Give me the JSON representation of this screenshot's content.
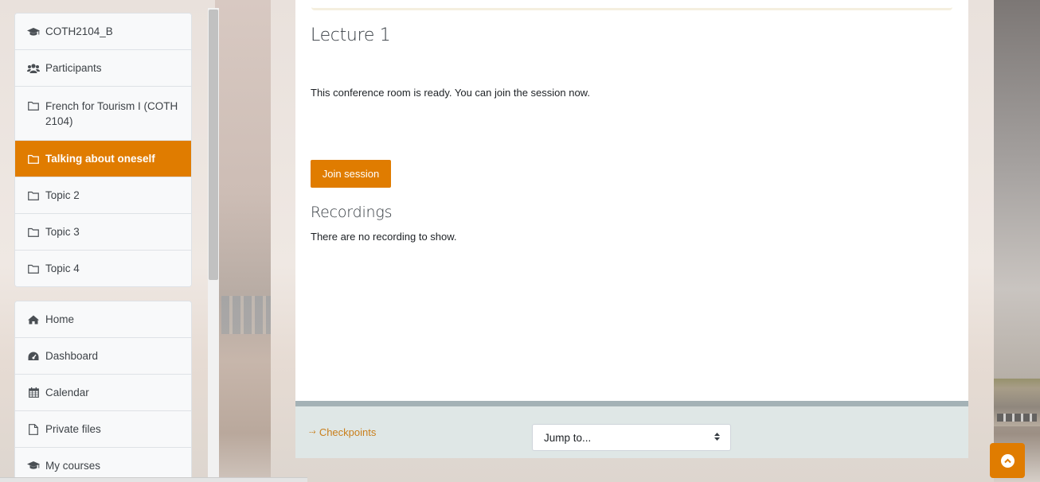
{
  "course_nav": [
    {
      "icon": "graduation-cap-icon",
      "label": "COTH2104_B",
      "active": false
    },
    {
      "icon": "users-icon",
      "label": "Participants",
      "active": false
    },
    {
      "icon": "folder-icon",
      "label": "French for Tourism I (COTH 2104)",
      "active": false
    },
    {
      "icon": "folder-icon",
      "label": "Talking about oneself",
      "active": true
    },
    {
      "icon": "folder-icon",
      "label": "Topic 2",
      "active": false
    },
    {
      "icon": "folder-icon",
      "label": "Topic 3",
      "active": false
    },
    {
      "icon": "folder-icon",
      "label": "Topic 4",
      "active": false
    }
  ],
  "site_nav": [
    {
      "icon": "home-icon",
      "label": "Home"
    },
    {
      "icon": "dashboard-icon",
      "label": "Dashboard"
    },
    {
      "icon": "calendar-icon",
      "label": "Calendar"
    },
    {
      "icon": "file-icon",
      "label": "Private files"
    },
    {
      "icon": "graduation-cap-icon",
      "label": "My courses"
    }
  ],
  "activity": {
    "title": "Lecture 1",
    "status": "This conference room is ready. You can join the session now.",
    "join_label": "Join session",
    "recordings_title": "Recordings",
    "recordings_empty": "There are no recording to show."
  },
  "footer": {
    "checkpoints_label": "Checkpoints",
    "jump_to": "Jump to..."
  },
  "colors": {
    "accent": "#e07c00",
    "footer_bg": "#dfe7e6"
  }
}
